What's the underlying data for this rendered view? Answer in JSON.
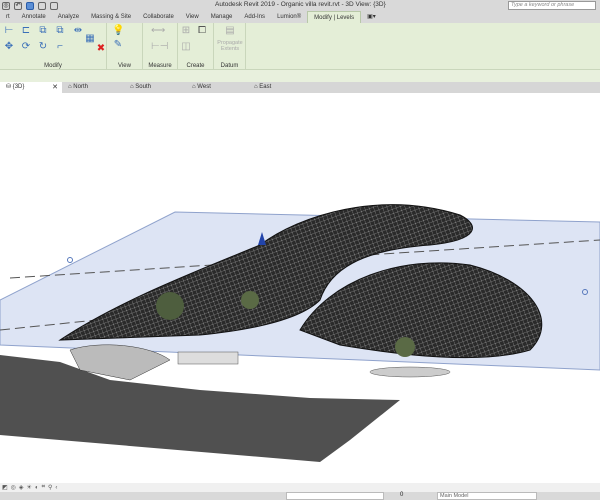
{
  "titlebar": {
    "title": "Autodesk Revit 2019 - Organic villa revit.rvt - 3D View: {3D}",
    "search_placeholder": "Type a keyword or phrase"
  },
  "ribbon_tabs": [
    "rt",
    "Annotate",
    "Analyze",
    "Massing & Site",
    "Collaborate",
    "View",
    "Manage",
    "Add-Ins",
    "Lumion®",
    "Modify | Levels",
    "▣▾"
  ],
  "active_tab": "Modify | Levels",
  "panels": {
    "modify": "Modify",
    "view": "View",
    "measure": "Measure",
    "create": "Create",
    "datum": "Datum",
    "propagate": "Propagate Extents"
  },
  "view_tabs": [
    {
      "label": "{3D}",
      "icon": "3d-view-icon",
      "active": true
    },
    {
      "label": "North",
      "icon": "elevation-icon"
    },
    {
      "label": "South",
      "icon": "elevation-icon"
    },
    {
      "label": "West",
      "icon": "elevation-icon"
    },
    {
      "label": "East",
      "icon": "elevation-icon"
    }
  ],
  "status": {
    "workset": "0",
    "model": "Main Model"
  }
}
